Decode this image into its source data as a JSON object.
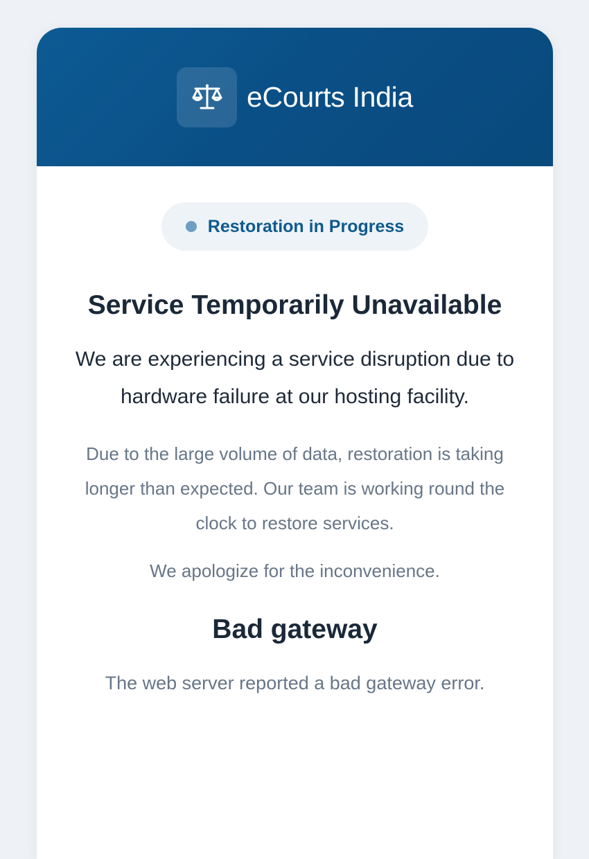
{
  "header": {
    "brand": "eCourts India",
    "logo_icon": "scales-of-justice-icon"
  },
  "status": {
    "badge_label": "Restoration in Progress",
    "dot_color": "#6e9ec4"
  },
  "notice": {
    "title": "Service Temporarily Unavailable",
    "lead": "We are experiencing a service disruption due to hardware failure at our hosting facility.",
    "detail": "Due to the large volume of data, restoration is taking longer than expected. Our team is working round the clock to restore services.",
    "apology": "We apologize for the inconvenience."
  },
  "error": {
    "title": "Bad gateway",
    "message": "The web server reported a bad gateway error."
  },
  "colors": {
    "header_bg": "#0a4f86",
    "accent": "#0e5a8e",
    "background": "#eef2f6"
  }
}
